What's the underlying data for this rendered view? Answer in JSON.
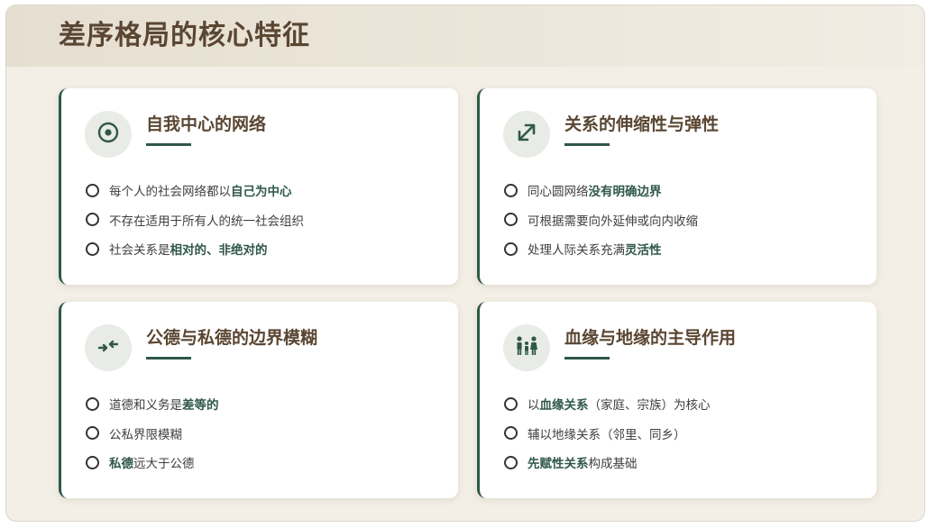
{
  "page": {
    "title": "差序格局的核心特征"
  },
  "colors": {
    "accent": "#2f5848",
    "title_brown": "#5a4632",
    "background": "#f3efe6",
    "card": "#ffffff"
  },
  "cards": [
    {
      "icon": "target-icon",
      "title": "自我中心的网络",
      "items": [
        {
          "parts": [
            "每个人的社会网络都以",
            "自己为中心",
            ""
          ]
        },
        {
          "parts": [
            "不存在适用于所有人的统一社会组织",
            "",
            ""
          ]
        },
        {
          "parts": [
            "社会关系是",
            "相对的、非绝对的",
            ""
          ]
        }
      ]
    },
    {
      "icon": "expand-arrows-icon",
      "title": "关系的伸缩性与弹性",
      "items": [
        {
          "parts": [
            "同心圆网络",
            "没有明确边界",
            ""
          ]
        },
        {
          "parts": [
            "可根据需要向外延伸或向内收缩",
            "",
            ""
          ]
        },
        {
          "parts": [
            "处理人际关系充满",
            "灵活性",
            ""
          ]
        }
      ]
    },
    {
      "icon": "compress-arrows-icon",
      "title": "公德与私德的边界模糊",
      "items": [
        {
          "parts": [
            "道德和义务是",
            "差等的",
            ""
          ]
        },
        {
          "parts": [
            "公私界限模糊",
            "",
            ""
          ]
        },
        {
          "parts": [
            "",
            "私德",
            "远大于公德"
          ]
        }
      ]
    },
    {
      "icon": "family-icon",
      "title": "血缘与地缘的主导作用",
      "items": [
        {
          "parts": [
            "以",
            "血缘关系",
            "（家庭、宗族）为核心"
          ]
        },
        {
          "parts": [
            "辅以地缘关系（邻里、同乡）",
            "",
            ""
          ]
        },
        {
          "parts": [
            "",
            "先赋性关系",
            "构成基础"
          ]
        }
      ]
    }
  ]
}
